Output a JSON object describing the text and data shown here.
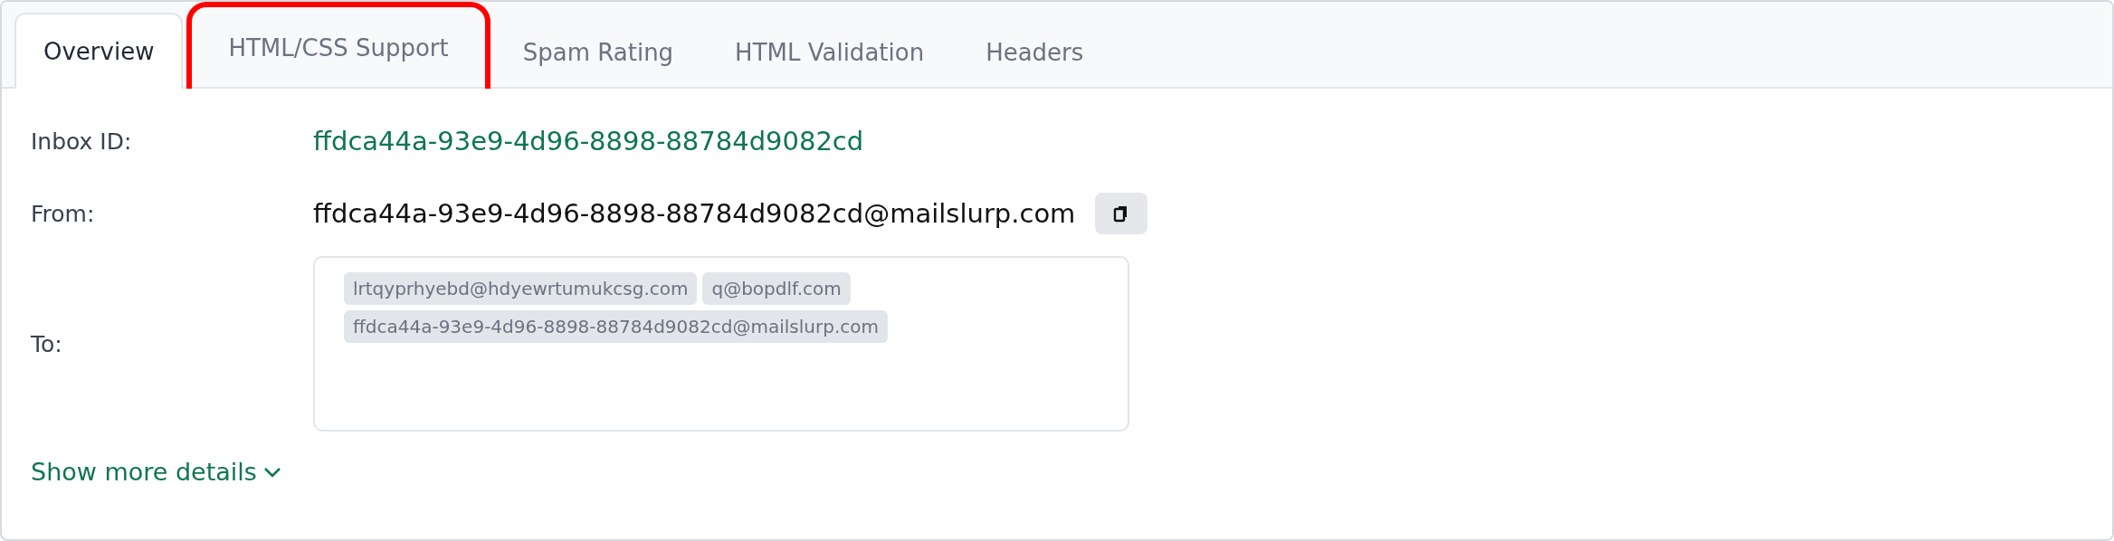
{
  "tabs": [
    {
      "label": "Overview",
      "selected": true,
      "highlighted": false
    },
    {
      "label": "HTML/CSS Support",
      "selected": false,
      "highlighted": true
    },
    {
      "label": "Spam Rating",
      "selected": false,
      "highlighted": false
    },
    {
      "label": "HTML Validation",
      "selected": false,
      "highlighted": false
    },
    {
      "label": "Headers",
      "selected": false,
      "highlighted": false
    }
  ],
  "inbox_id": {
    "label": "Inbox ID:",
    "value": "ffdca44a-93e9-4d96-8898-88784d9082cd"
  },
  "from": {
    "label": "From:",
    "value": "ffdca44a-93e9-4d96-8898-88784d9082cd@mailslurp.com"
  },
  "to": {
    "label": "To:",
    "recipients": [
      "lrtqyprhyebd@hdyewrtumukcsg.com",
      "q@bopdlf.com",
      "ffdca44a-93e9-4d96-8898-88784d9082cd@mailslurp.com"
    ]
  },
  "show_more": {
    "label": "Show more details"
  }
}
